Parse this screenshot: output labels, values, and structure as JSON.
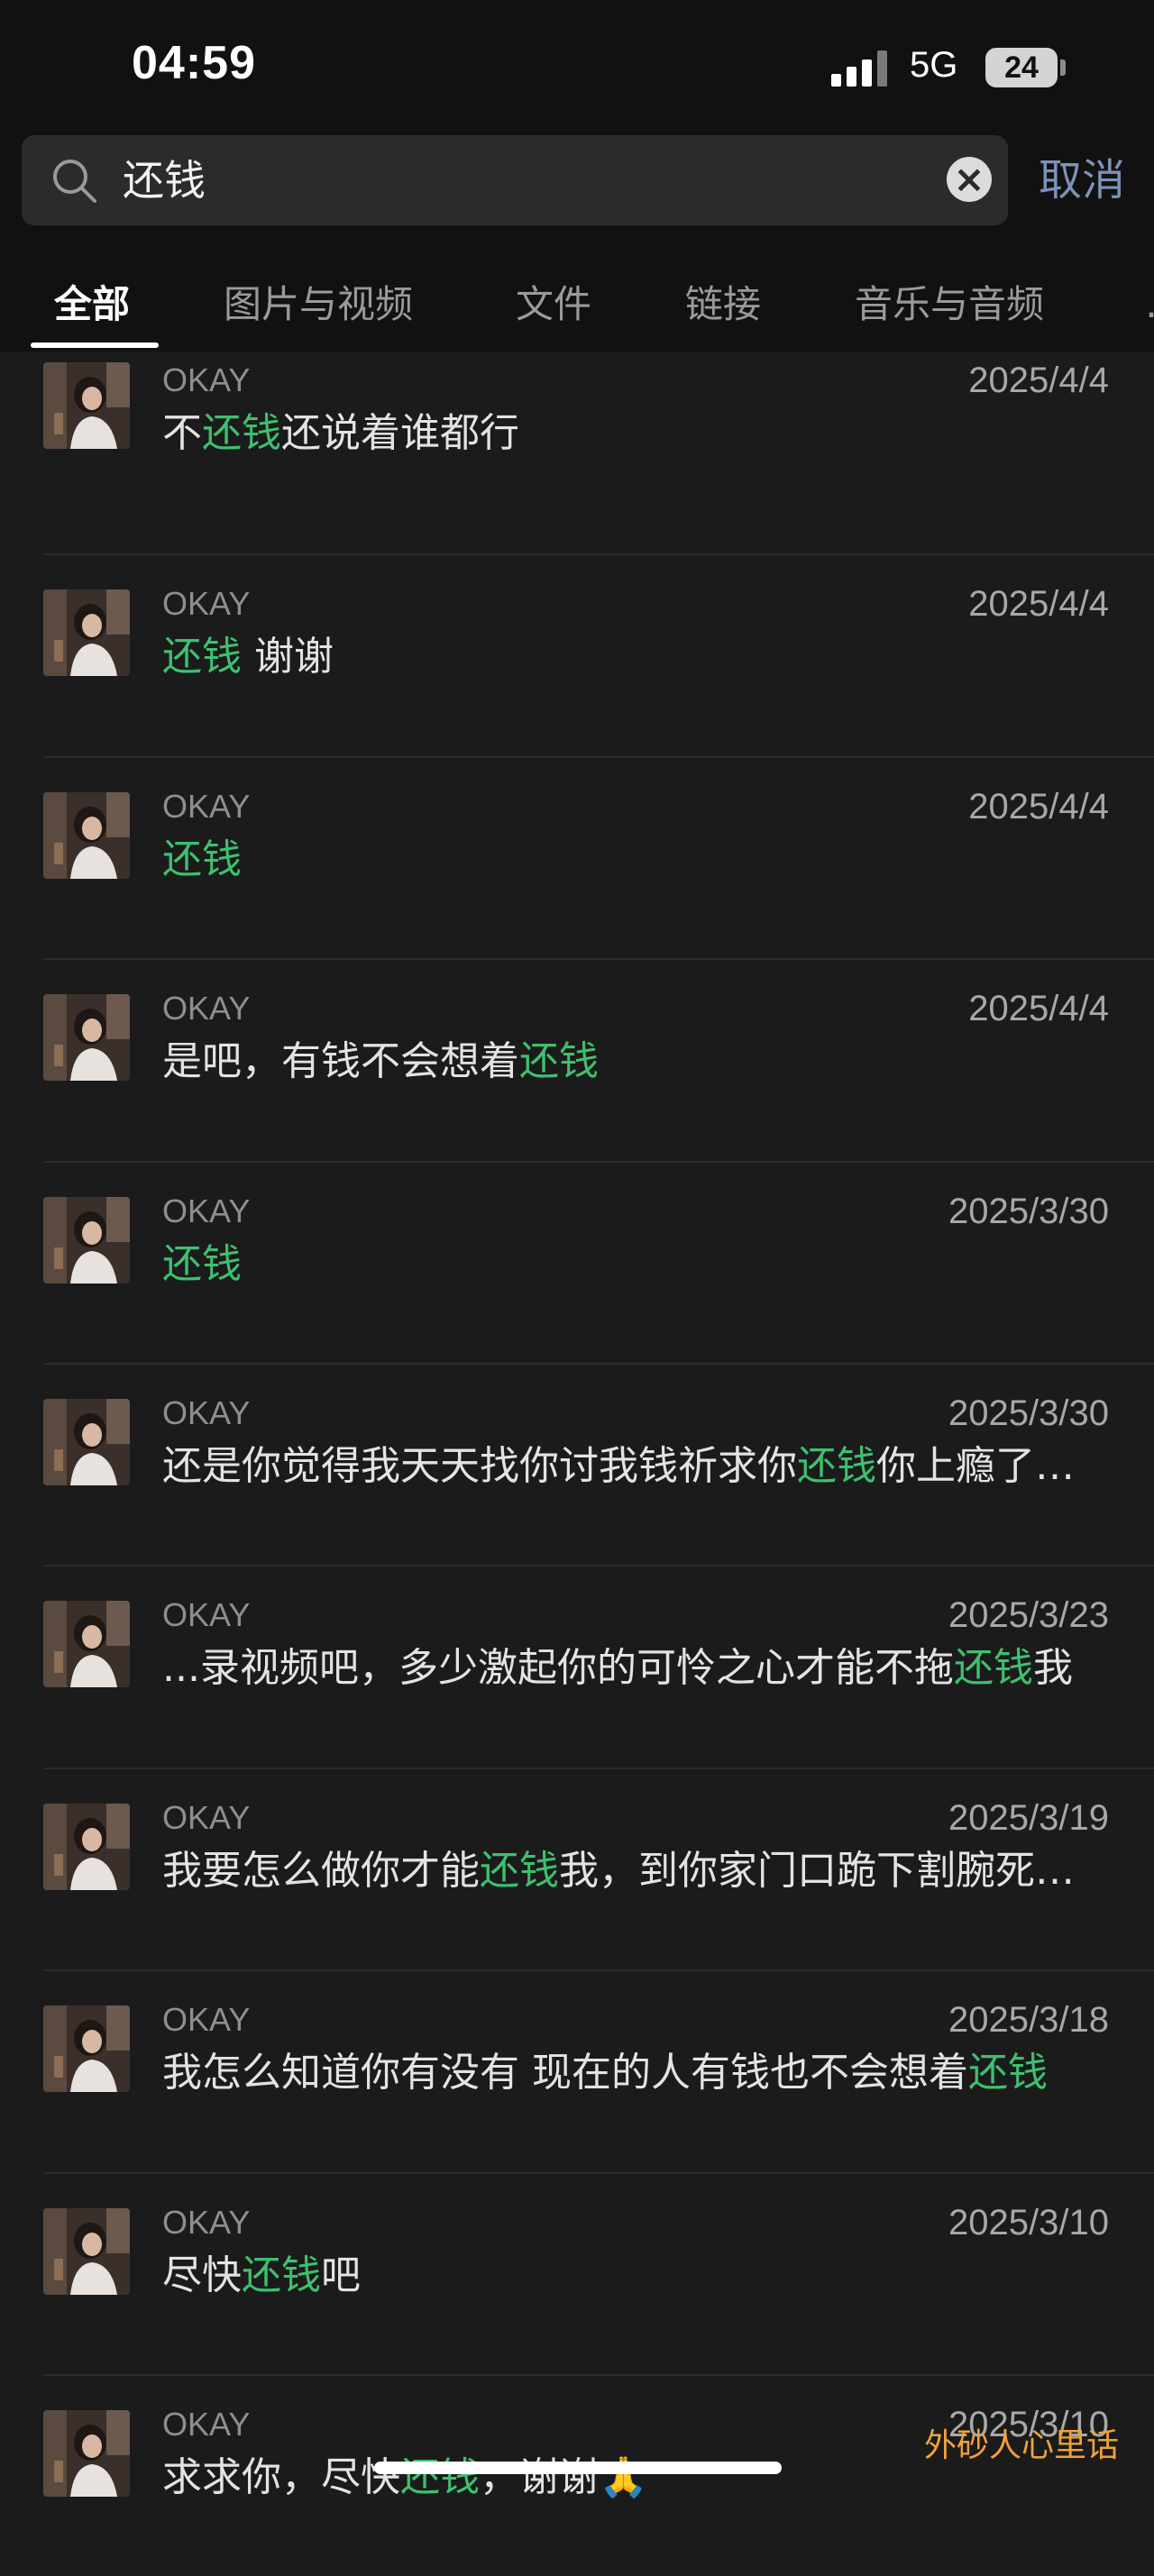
{
  "status_bar": {
    "time": "04:59",
    "network": "5G",
    "battery": "24"
  },
  "search": {
    "query": "还钱",
    "cancel_label": "取消"
  },
  "tabs": [
    {
      "label": "全部",
      "active": true
    },
    {
      "label": "图片与视频",
      "active": false
    },
    {
      "label": "文件",
      "active": false
    },
    {
      "label": "链接",
      "active": false
    },
    {
      "label": "音乐与音频",
      "active": false
    }
  ],
  "results": [
    {
      "sender": "OKAY",
      "date": "2025/4/4",
      "parts": [
        "不",
        "还钱",
        "还说着谁都行"
      ]
    },
    {
      "sender": "OKAY",
      "date": "2025/4/4",
      "parts": [
        "",
        "还钱",
        " 谢谢"
      ]
    },
    {
      "sender": "OKAY",
      "date": "2025/4/4",
      "parts": [
        "",
        "还钱",
        ""
      ]
    },
    {
      "sender": "OKAY",
      "date": "2025/4/4",
      "parts": [
        "是吧，有钱不会想着",
        "还钱",
        ""
      ]
    },
    {
      "sender": "OKAY",
      "date": "2025/3/30",
      "parts": [
        "",
        "还钱",
        ""
      ]
    },
    {
      "sender": "OKAY",
      "date": "2025/3/30",
      "parts": [
        "还是你觉得我天天找你讨我钱祈求你",
        "还钱",
        "你上瘾了…"
      ]
    },
    {
      "sender": "OKAY",
      "date": "2025/3/23",
      "parts": [
        "...录视频吧，多少激起你的可怜之心才能不拖",
        "还钱",
        "我"
      ]
    },
    {
      "sender": "OKAY",
      "date": "2025/3/19",
      "parts": [
        "我要怎么做你才能",
        "还钱",
        "我，到你家门口跪下割腕死…"
      ]
    },
    {
      "sender": "OKAY",
      "date": "2025/3/18",
      "parts": [
        "我怎么知道你有没有 现在的人有钱也不会想着",
        "还钱",
        ""
      ]
    },
    {
      "sender": "OKAY",
      "date": "2025/3/10",
      "parts": [
        "尽快",
        "还钱",
        "吧"
      ]
    },
    {
      "sender": "OKAY",
      "date": "2025/3/10",
      "parts": [
        "求求你，尽快",
        "还钱",
        "，谢谢🙏"
      ]
    }
  ],
  "watermark": "外砂人心里话",
  "colors": {
    "highlight": "#3ec070",
    "cancel": "#7d92b8",
    "watermark": "#f0a23a"
  }
}
